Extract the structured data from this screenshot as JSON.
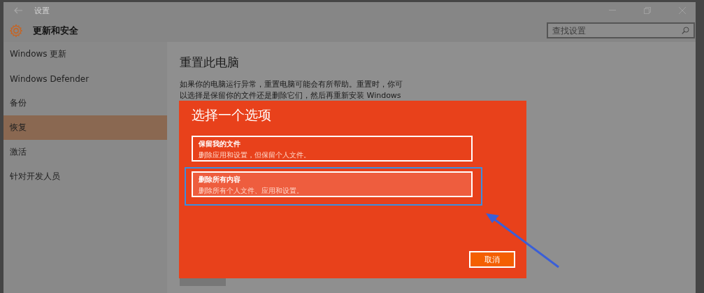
{
  "window": {
    "title": "设置"
  },
  "header": {
    "title": "更新和安全"
  },
  "search": {
    "placeholder": "查找设置"
  },
  "sidebar": {
    "items": [
      {
        "label": "Windows 更新",
        "selected": false
      },
      {
        "label": "Windows Defender",
        "selected": false
      },
      {
        "label": "备份",
        "selected": false
      },
      {
        "label": "恢复",
        "selected": true
      },
      {
        "label": "激活",
        "selected": false
      },
      {
        "label": "针对开发人员",
        "selected": false
      }
    ]
  },
  "content": {
    "heading": "重置此电脑",
    "description_lines": [
      "如果你的电脑运行异常，重置电脑可能会有所帮助。重置时，你可",
      "以选择是保留你的文件还是删除它们，然后再重新安装 Windows"
    ]
  },
  "dialog": {
    "title": "选择一个选项",
    "options": [
      {
        "title": "保留我的文件",
        "description": "删除应用和设置，但保留个人文件。",
        "selected": false
      },
      {
        "title": "删除所有内容",
        "description": "删除所有个人文件、应用和设置。",
        "selected": true
      }
    ],
    "cancel_button": "取消"
  }
}
